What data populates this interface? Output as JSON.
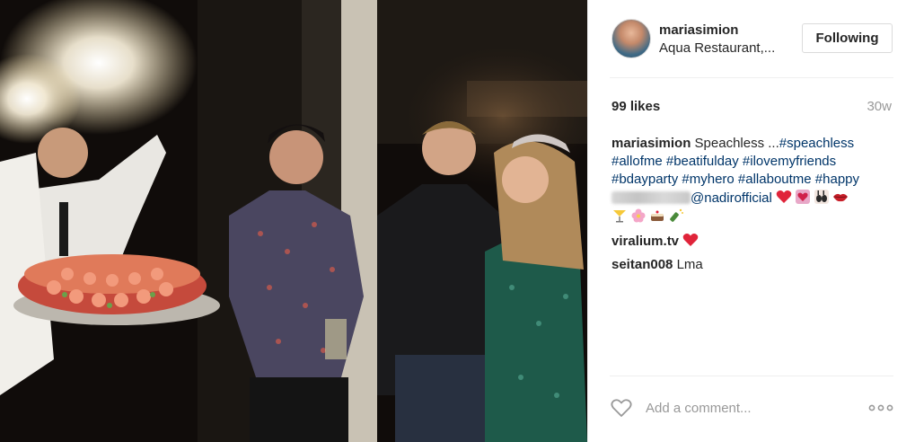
{
  "post": {
    "photo_alt": "Party photo",
    "author": {
      "username": "mariasimion",
      "location": "Aqua Restaurant,..."
    },
    "follow_button": "Following",
    "likes": "99 likes",
    "time_ago": "30w",
    "caption": {
      "username": "mariasimion",
      "lead": "Speachless ...",
      "tags_line1": "#speachless",
      "tags_line2": "#allofme #beatifulday #ilovemyfriends",
      "tags_line3": "#bdayparty #myhero #allaboutme #happy",
      "mention": "@nadirofficial"
    },
    "comments": [
      {
        "username": "viralium.tv",
        "text": ""
      },
      {
        "username": "seitan008",
        "text": "Lma"
      }
    ],
    "add_comment_placeholder": "Add a comment...",
    "icons": {
      "like": "heart-outline-icon",
      "more": "more-options-icon"
    },
    "colors": {
      "text": "#262626",
      "muted": "#999999",
      "link": "#003569",
      "heart": "#ed4956",
      "border": "#dbdbdb"
    }
  }
}
